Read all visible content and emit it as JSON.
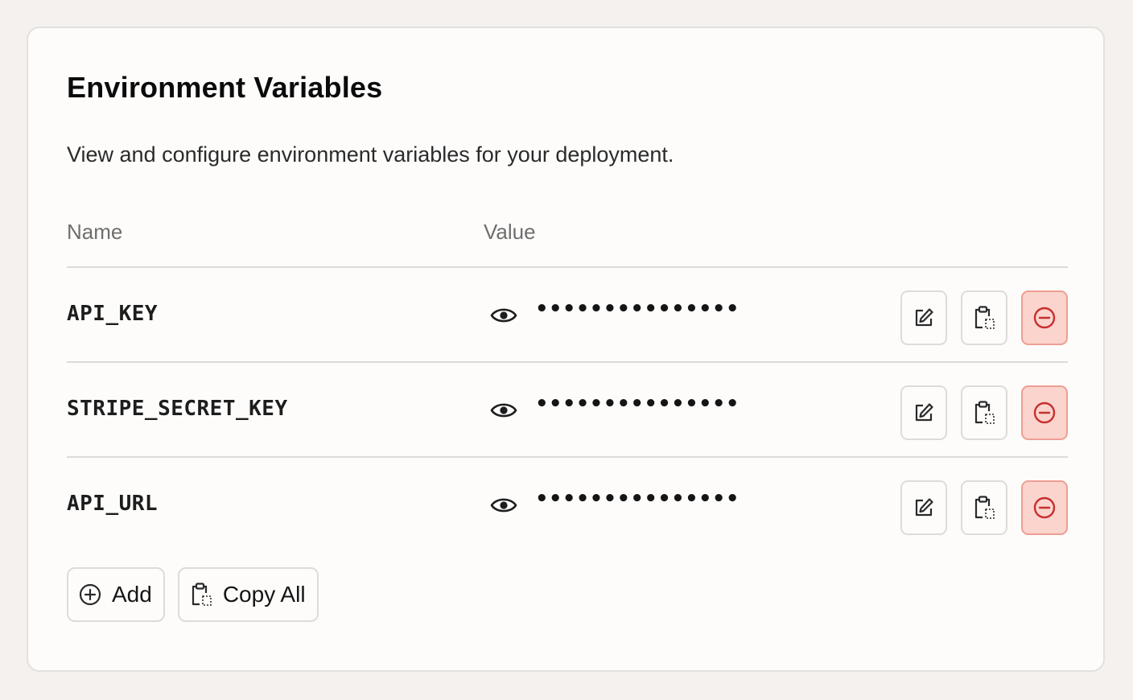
{
  "panel": {
    "title": "Environment Variables",
    "subtitle": "View and configure environment variables for your deployment."
  },
  "table": {
    "columns": {
      "name": "Name",
      "value": "Value"
    },
    "rows": [
      {
        "name": "API_KEY",
        "masked_value": "•••••••••••••••"
      },
      {
        "name": "STRIPE_SECRET_KEY",
        "masked_value": "•••••••••••••••"
      },
      {
        "name": "API_URL",
        "masked_value": "•••••••••••••••"
      }
    ]
  },
  "actions": {
    "add_label": "Add",
    "copy_all_label": "Copy All"
  },
  "icons": {
    "reveal": "eye-icon",
    "edit": "edit-icon",
    "copy": "clipboard-icon",
    "remove": "remove-icon",
    "add": "plus-circle-icon"
  },
  "colors": {
    "background": "#f4f1ee",
    "card": "#fdfcfb",
    "danger_bg": "#fad4cd",
    "danger_border": "#ee9e93",
    "danger_icon": "#c62f2f"
  }
}
